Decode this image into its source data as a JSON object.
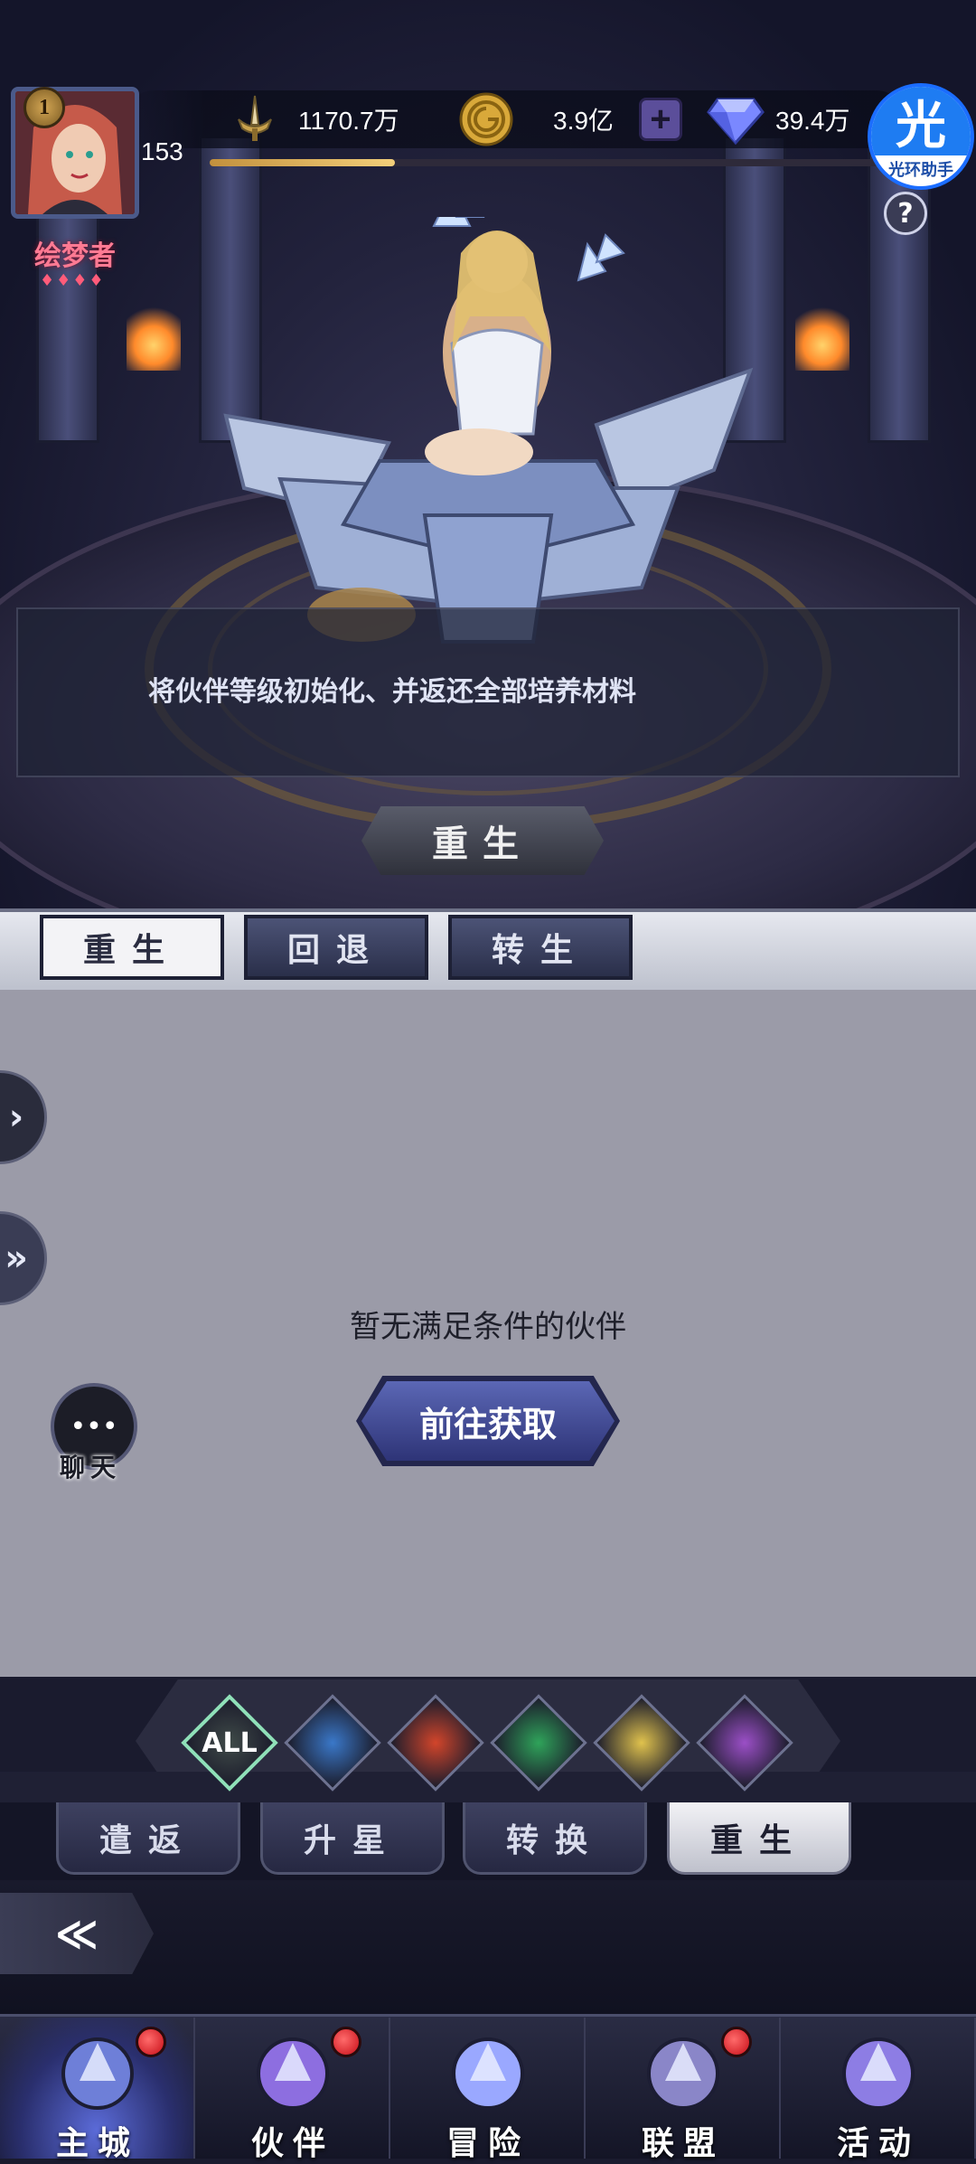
{
  "header": {
    "player_level_badge": "1",
    "player_level": "153",
    "xp_progress_percent": 27,
    "title_tag": "绘梦者",
    "title_gems": "♦♦♦♦",
    "power": "1170.7万",
    "gold": "3.9亿",
    "gold_add": "+",
    "diamonds": "39.4万",
    "assistant_glyph": "光",
    "assistant_label": "光环助手",
    "help": "?"
  },
  "scene": {
    "description": "将伙伴等级初始化、并返还全部培养材料",
    "action_button": "重生"
  },
  "panel_tabs": [
    {
      "label": "重生",
      "active": true
    },
    {
      "label": "回退",
      "active": false
    },
    {
      "label": "转生",
      "active": false
    }
  ],
  "content": {
    "empty_text": "暂无满足条件的伙伴",
    "go_button": "前往获取"
  },
  "side": {
    "arrow_1": "›",
    "arrow_2": "»",
    "chat_icon": "•••",
    "chat_label": "聊天"
  },
  "elements": [
    {
      "key": "all",
      "label": "ALL",
      "color": "#3f4a48"
    },
    {
      "key": "water",
      "label": "",
      "color": "#3a78c9"
    },
    {
      "key": "fire",
      "label": "",
      "color": "#d2452b"
    },
    {
      "key": "wind",
      "label": "",
      "color": "#2fa35a"
    },
    {
      "key": "light",
      "label": "",
      "color": "#e0c24d"
    },
    {
      "key": "dark",
      "label": "",
      "color": "#9b4fc7"
    }
  ],
  "category_tabs": [
    {
      "label": "遣返",
      "active": false
    },
    {
      "label": "升星",
      "active": false
    },
    {
      "label": "转换",
      "active": false
    },
    {
      "label": "重生",
      "active": true
    }
  ],
  "back": "≪",
  "nav": [
    {
      "label": "主城",
      "active": true,
      "badge": true
    },
    {
      "label": "伙伴",
      "active": false,
      "badge": true
    },
    {
      "label": "冒险",
      "active": false,
      "badge": false
    },
    {
      "label": "联盟",
      "active": false,
      "badge": true
    },
    {
      "label": "活动",
      "active": false,
      "badge": false
    }
  ]
}
